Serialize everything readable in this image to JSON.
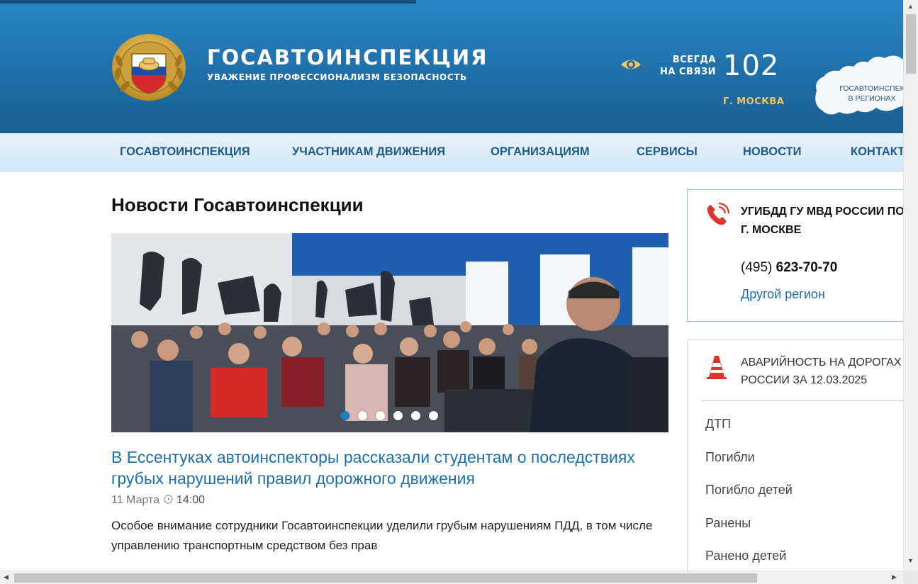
{
  "header": {
    "brand_title": "ГОСАВТОИНСПЕКЦИЯ",
    "brand_subtitle": "УВАЖЕНИЕ ПРОФЕССИОНАЛИЗМ БЕЗОПАСНОСТЬ",
    "always_line1": "ВСЕГДА",
    "always_line2": "НА СВЯЗИ",
    "phone": "102",
    "city": "Г. МОСКВА",
    "map_line1": "ГОСАВТОИНСПЕК",
    "map_line2": "В РЕГИОНАХ",
    "accent_color": "#f2c45a",
    "icons": [
      "emblem-icon",
      "eye-icon",
      "russia-map-icon"
    ]
  },
  "nav": {
    "items": [
      {
        "label": "ГОСАВТОИНСПЕКЦИЯ"
      },
      {
        "label": "УЧАСТНИКАМ ДВИЖЕНИЯ"
      },
      {
        "label": "ОРГАНИЗАЦИЯМ"
      },
      {
        "label": "СЕРВИСЫ"
      },
      {
        "label": "НОВОСТИ"
      },
      {
        "label": "КОНТАКТ"
      }
    ]
  },
  "main": {
    "page_title": "Новости Госавтоинспекции",
    "slider": {
      "dot_count": 6,
      "active_index": 0
    },
    "news": {
      "title": "В Ессентуках автоинспекторы рассказали студентам о последствиях грубых нарушений правил дорожного движения",
      "date": "11 Марта",
      "time": "14:00",
      "text": "Особое внимание сотрудники Госавтоинспекции уделили грубым нарушениям ПДД, в том числе управлению транспортным средством без прав"
    }
  },
  "sidebar": {
    "contact": {
      "org": "УГИБДД ГУ МВД РОССИИ ПО Г. МОСКВЕ",
      "phone_code": "(495)",
      "phone_number": "623-70-70",
      "other_region": "Другой регион"
    },
    "stats": {
      "title": "АВАРИЙНОСТЬ НА ДОРОГАХ РОССИИ ЗА 12.03.2025",
      "rows": [
        {
          "label": "ДТП"
        },
        {
          "label": "Погибли"
        },
        {
          "label": "Погибло детей"
        },
        {
          "label": "Ранены"
        },
        {
          "label": "Ранено детей"
        }
      ]
    }
  },
  "colors": {
    "header_blue": "#1f6fa9",
    "link_blue": "#1f6fa9",
    "nav_text": "#1f5a86",
    "icon_red": "#d9362c"
  }
}
